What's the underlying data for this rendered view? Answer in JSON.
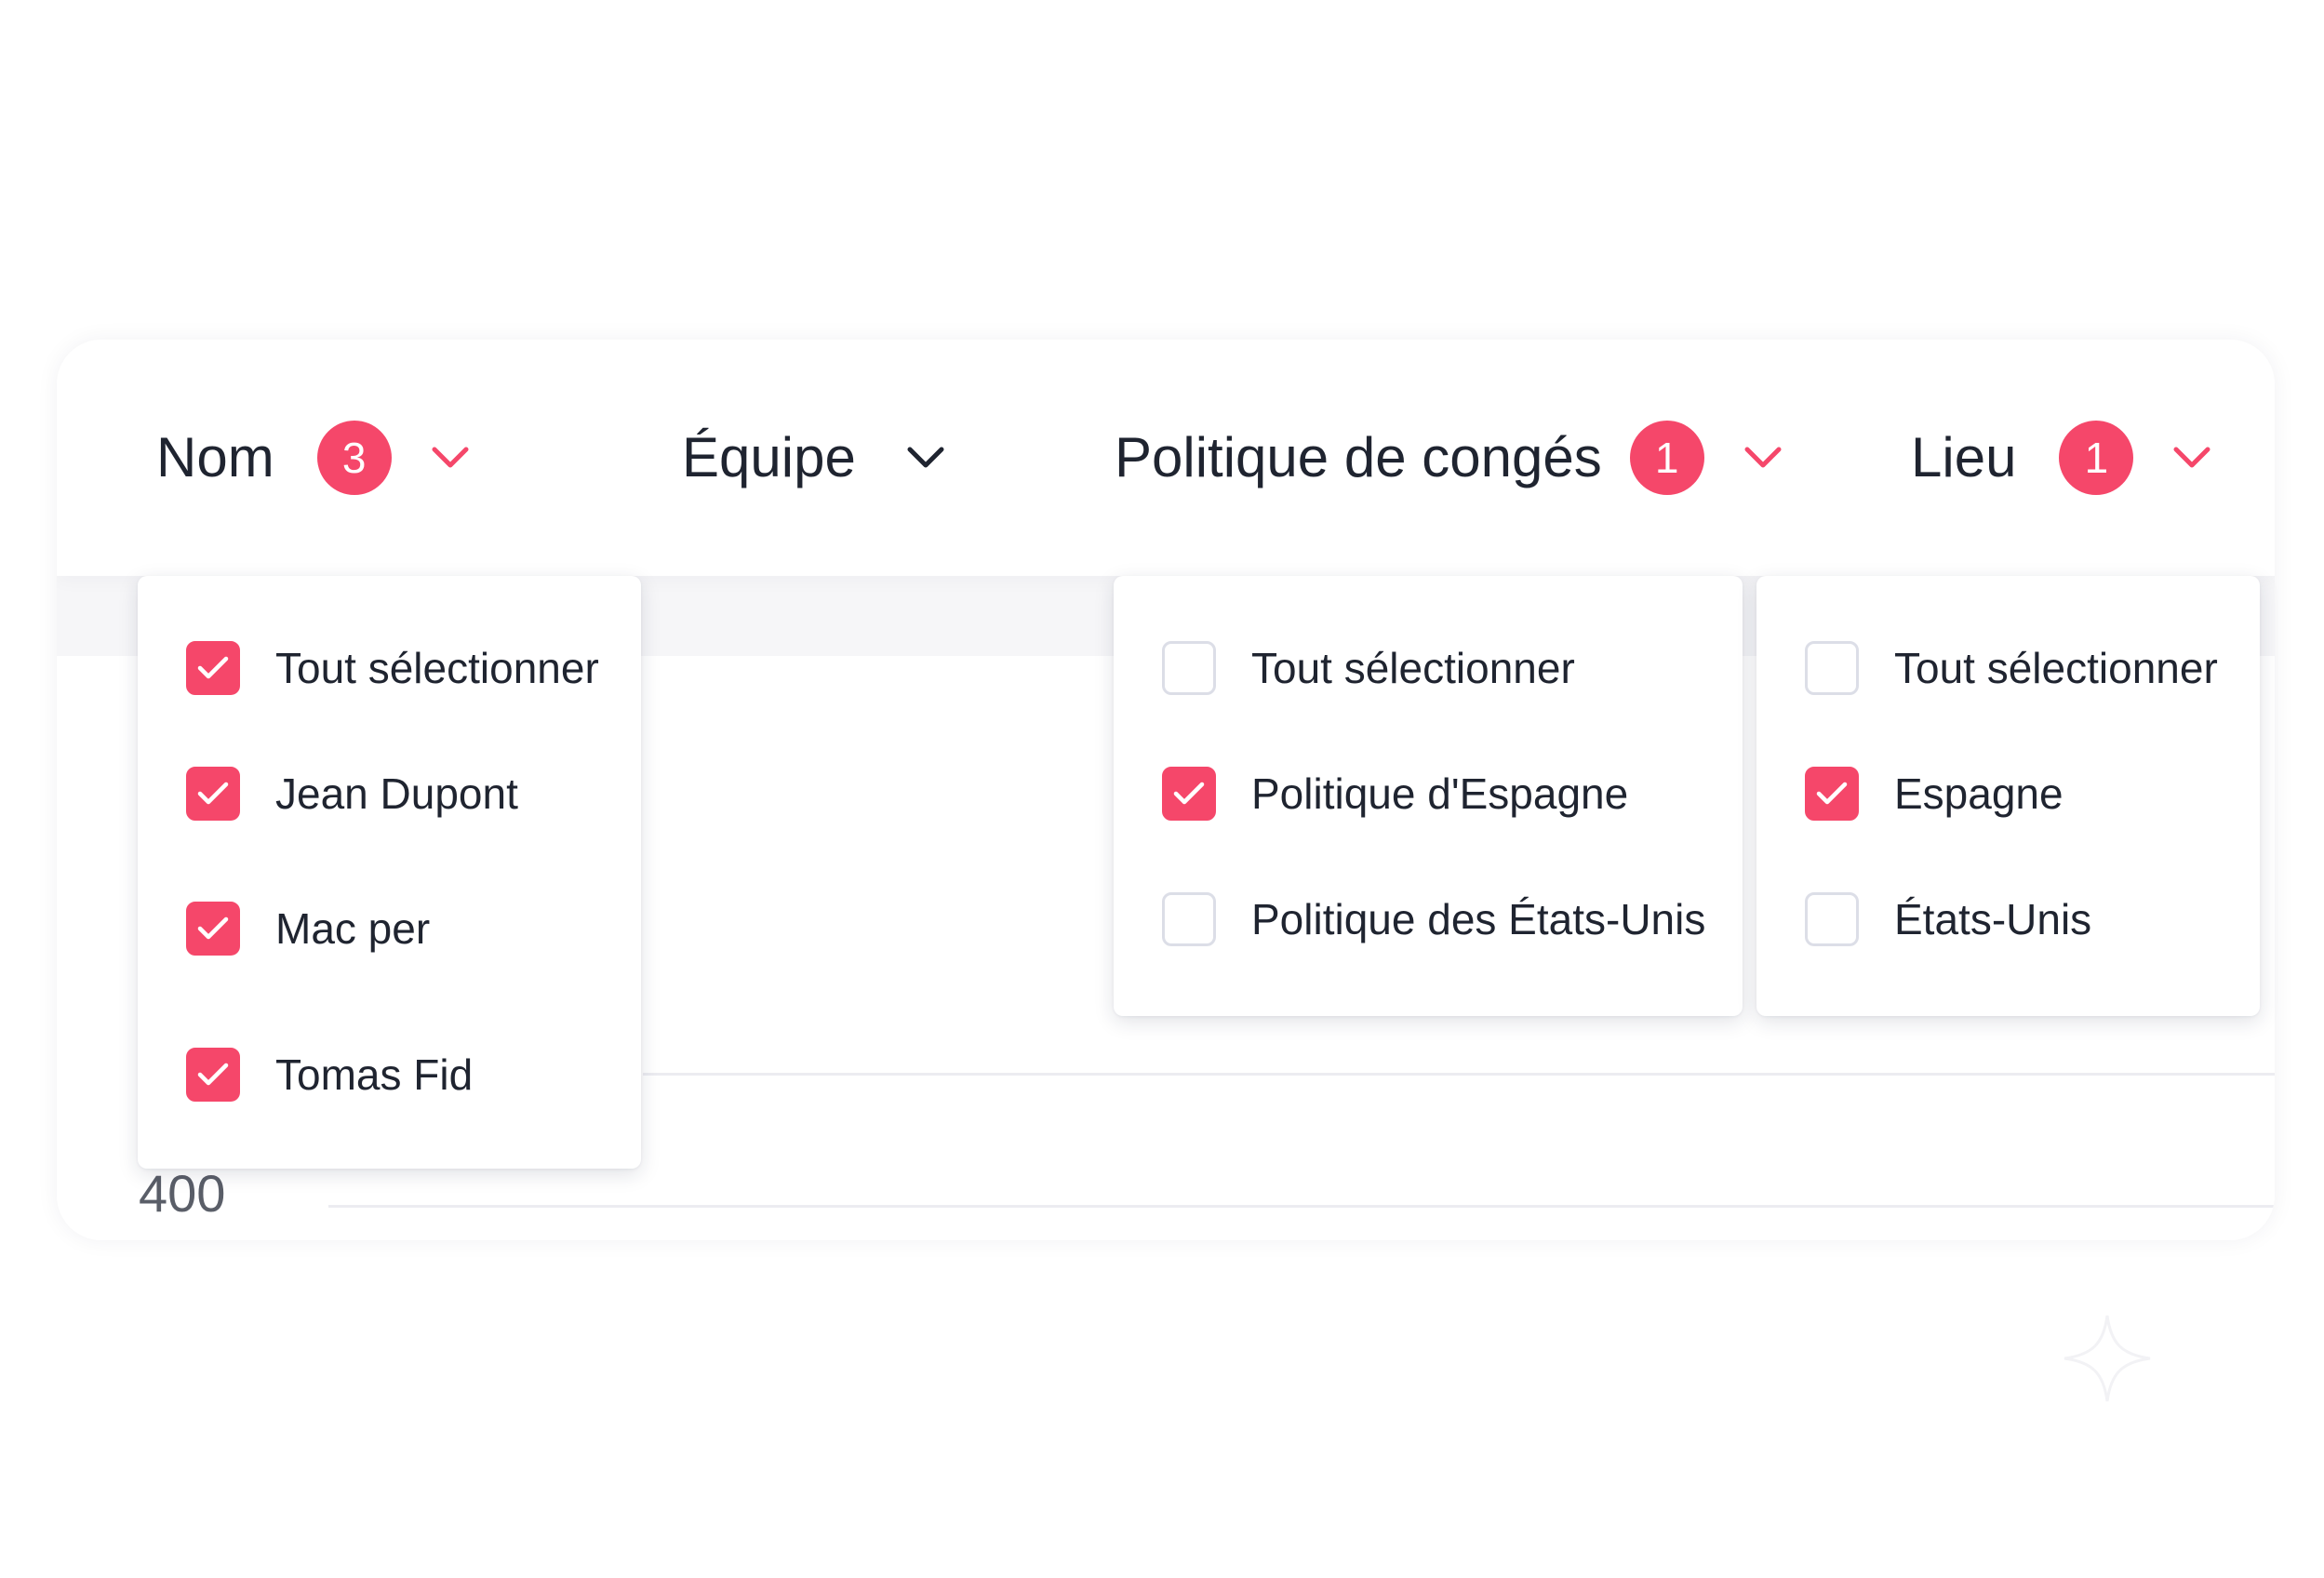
{
  "colors": {
    "accent": "#f5476a",
    "text": "#1f2430",
    "checkbox_border": "#dcdee7",
    "grid": "#ececf1"
  },
  "filters": [
    {
      "label": "Nom",
      "badge": "3",
      "icon": "chevron-down-icon",
      "icon_color": "#f5476a"
    },
    {
      "label": "Équipe",
      "badge": "",
      "icon": "chevron-down-icon",
      "icon_color": "#1f2430"
    },
    {
      "label": "Politique de congés",
      "badge": "1",
      "icon": "chevron-down-icon",
      "icon_color": "#f5476a"
    },
    {
      "label": "Lieu",
      "badge": "1",
      "icon": "chevron-down-icon",
      "icon_color": "#f5476a"
    }
  ],
  "dropdowns": {
    "nom": {
      "options": [
        {
          "label": "Tout sélectionner",
          "checked": true
        },
        {
          "label": "Jean Dupont",
          "checked": true
        },
        {
          "label": "Mac per",
          "checked": true
        },
        {
          "label": "Tomas Fid",
          "checked": true
        }
      ]
    },
    "politique": {
      "options": [
        {
          "label": "Tout sélectionner",
          "checked": false
        },
        {
          "label": "Politique d'Espagne",
          "checked": true
        },
        {
          "label": "Politique des États-Unis",
          "checked": false
        }
      ]
    },
    "lieu": {
      "options": [
        {
          "label": "Tout sélectionner",
          "checked": false
        },
        {
          "label": "Espagne",
          "checked": true
        },
        {
          "label": "États-Unis",
          "checked": false
        }
      ]
    }
  },
  "chart": {
    "axis_label": "400"
  }
}
